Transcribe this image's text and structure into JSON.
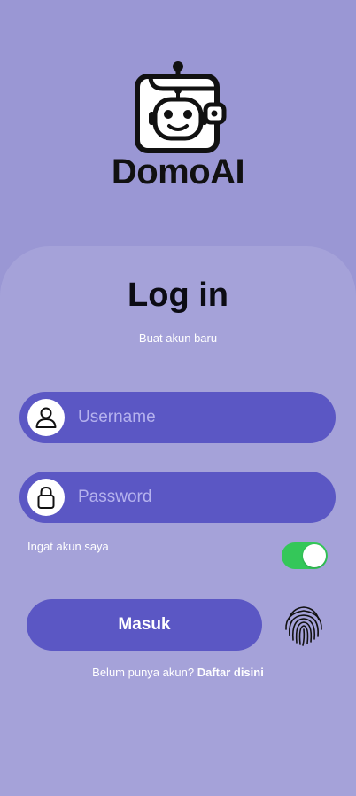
{
  "app": {
    "logo_text": "DomoAI",
    "logo_icon": "robot-wallet-icon"
  },
  "login": {
    "title": "Log in",
    "subtitle": "Buat akun baru",
    "username": {
      "placeholder": "Username",
      "value": "",
      "icon": "user-icon"
    },
    "password": {
      "placeholder": "Password",
      "value": "",
      "icon": "lock-icon"
    },
    "remember": {
      "label": "Ingat akun saya",
      "checked": true
    },
    "submit_label": "Masuk",
    "biometric_icon": "fingerprint-icon",
    "signup_prompt": "Belum punya akun?",
    "signup_link": "Daftar disini"
  },
  "colors": {
    "background": "#9a97d4",
    "card": "#a5a2d9",
    "accent": "#5b57c4",
    "toggle_on": "#34c759",
    "title": "#0c0c14"
  }
}
